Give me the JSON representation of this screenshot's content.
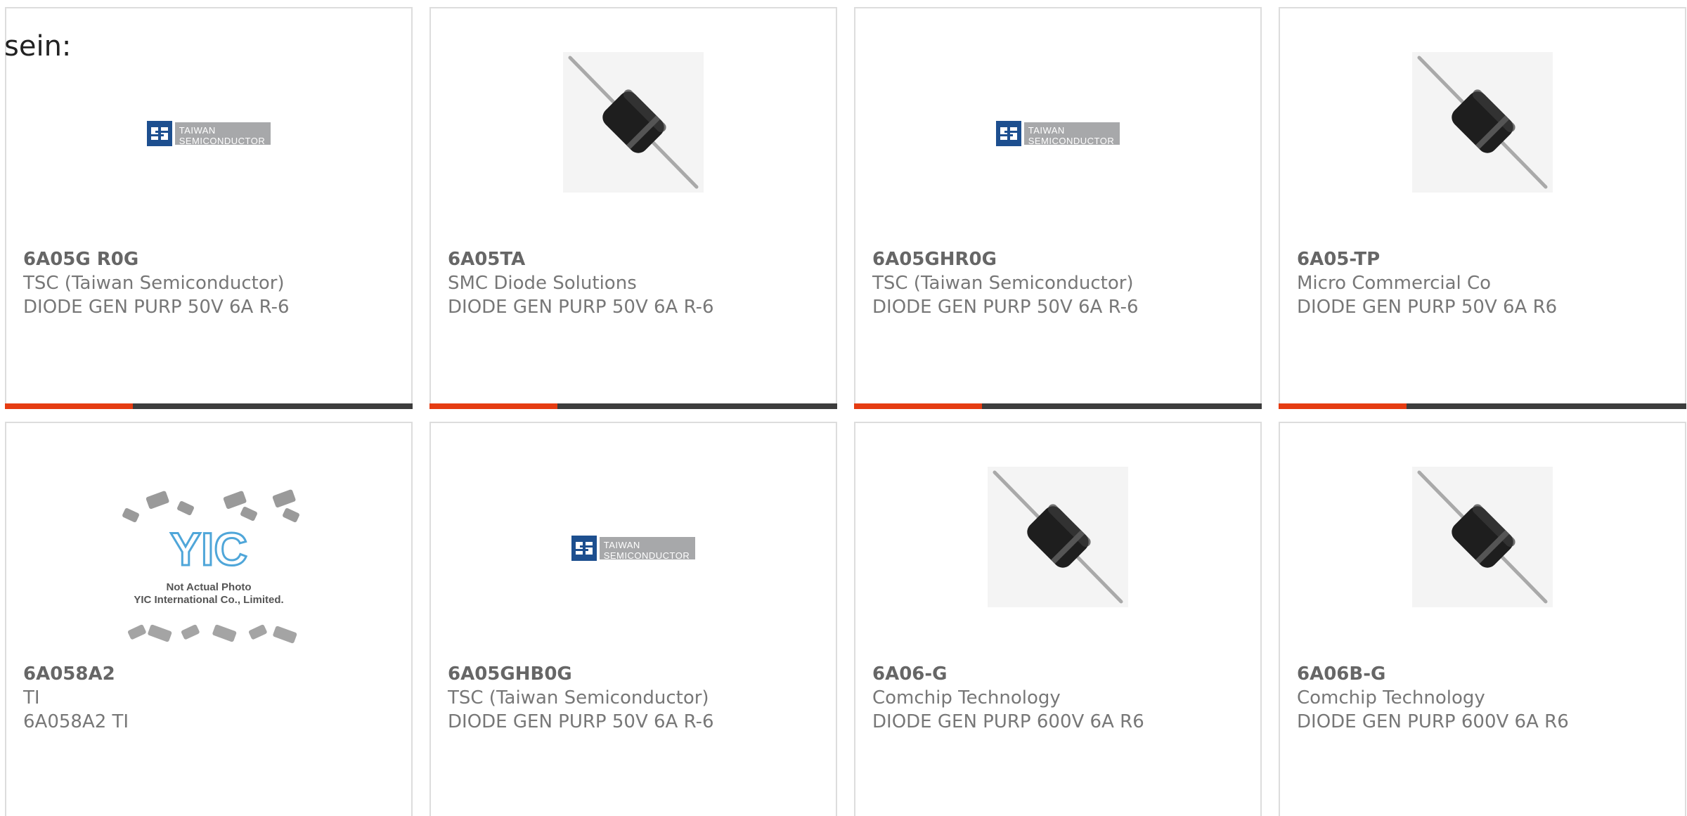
{
  "intro_text": "sein:",
  "colors": {
    "accent_bar": "#e53c12",
    "bar_rest": "#3d3d3d",
    "card_border": "#dddddd",
    "text": "#777777"
  },
  "cards": [
    {
      "part": "6A05G R0G",
      "manufacturer": "TSC (Taiwan Semiconductor)",
      "description": "DIODE GEN PURP 50V 6A R-6",
      "image": "taiwan-semiconductor-logo",
      "logo_lines": [
        "TAIWAN",
        "SEMICONDUCTOR"
      ]
    },
    {
      "part": "6A05TA",
      "manufacturer": "SMC Diode Solutions",
      "description": "DIODE GEN PURP 50V 6A R-6",
      "image": "diode-photo"
    },
    {
      "part": "6A05GHR0G",
      "manufacturer": "TSC (Taiwan Semiconductor)",
      "description": "DIODE GEN PURP 50V 6A R-6",
      "image": "taiwan-semiconductor-logo",
      "logo_lines": [
        "TAIWAN",
        "SEMICONDUCTOR"
      ]
    },
    {
      "part": "6A05-TP",
      "manufacturer": "Micro Commercial Co",
      "description": "DIODE GEN PURP 50V 6A R6",
      "image": "diode-photo"
    },
    {
      "part": "6A058A2",
      "manufacturer": "TI",
      "description": "6A058A2 TI",
      "image": "yic-placeholder",
      "placeholder_lines": [
        "Not Actual Photo",
        "YIC International Co., Limited."
      ]
    },
    {
      "part": "6A05GHB0G",
      "manufacturer": "TSC (Taiwan Semiconductor)",
      "description": "DIODE GEN PURP 50V 6A R-6",
      "image": "taiwan-semiconductor-logo",
      "logo_lines": [
        "TAIWAN",
        "SEMICONDUCTOR"
      ]
    },
    {
      "part": "6A06-G",
      "manufacturer": "Comchip Technology",
      "description": "DIODE GEN PURP 600V 6A R6",
      "image": "diode-photo"
    },
    {
      "part": "6A06B-G",
      "manufacturer": "Comchip Technology",
      "description": "DIODE GEN PURP 600V 6A R6",
      "image": "diode-photo"
    }
  ]
}
